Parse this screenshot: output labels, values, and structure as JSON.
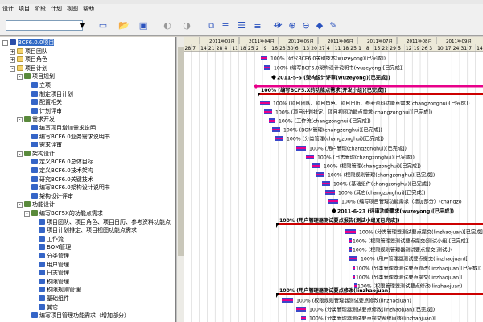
{
  "menu": [
    "设计",
    "项目",
    "阶段",
    "计划",
    "视图",
    "帮助"
  ],
  "toolbar": {
    "search_value": "",
    "search_icon": "filter-icon",
    "buttons": [
      "page-icon",
      "open-icon",
      "save-icon",
      "undo-icon",
      "redo-icon",
      "copy-icon",
      "paste-icon",
      "align-icon",
      "align-center-icon",
      "indent-icon",
      "refresh-icon",
      "zoom-in-icon",
      "zoom-out-icon",
      "tag-icon",
      "paint-icon"
    ]
  },
  "tree": [
    {
      "level": 0,
      "label": "BCF6.0.0项目",
      "icon": "root",
      "expander": "-",
      "selected": true
    },
    {
      "level": 1,
      "label": "项目团队",
      "icon": "folder",
      "expander": "+"
    },
    {
      "level": 1,
      "label": "项目角色",
      "icon": "folder",
      "expander": "+"
    },
    {
      "level": 1,
      "label": "项目计划",
      "icon": "folder",
      "expander": "-"
    },
    {
      "level": 2,
      "label": "项目规划",
      "icon": "summary",
      "expander": "-"
    },
    {
      "level": 3,
      "label": "立项",
      "icon": "task"
    },
    {
      "level": 3,
      "label": "制定项目计划",
      "icon": "task"
    },
    {
      "level": 3,
      "label": "配置相关",
      "icon": "task"
    },
    {
      "level": 3,
      "label": "计划评审",
      "icon": "task"
    },
    {
      "level": 2,
      "label": "需求开发",
      "icon": "summary",
      "expander": "-"
    },
    {
      "level": 3,
      "label": "编写项目增加需求说明",
      "icon": "task"
    },
    {
      "level": 3,
      "label": "编写BCF6.0业务需求说明书",
      "icon": "task"
    },
    {
      "level": 3,
      "label": "需求评审",
      "icon": "task"
    },
    {
      "level": 2,
      "label": "架构设计",
      "icon": "summary",
      "expander": "-"
    },
    {
      "level": 3,
      "label": "定义BCF6.0总体目标",
      "icon": "task"
    },
    {
      "level": 3,
      "label": "定义BCF6.0技术架构",
      "icon": "task"
    },
    {
      "level": 3,
      "label": "研究BCF6.0关键技术",
      "icon": "task"
    },
    {
      "level": 3,
      "label": "编写BCF6.0架构设计说明书",
      "icon": "task"
    },
    {
      "level": 3,
      "label": "架构设计评审",
      "icon": "task"
    },
    {
      "level": 2,
      "label": "功能设计",
      "icon": "summary",
      "expander": "-"
    },
    {
      "level": 3,
      "label": "编写BCF5X的功能点需求",
      "icon": "summary",
      "expander": "-"
    },
    {
      "level": 4,
      "label": "项目团队、项目角色、项目日历、参考资料功能点",
      "icon": "task"
    },
    {
      "level": 4,
      "label": "项目计划排定、项目视图功能点需求",
      "icon": "task"
    },
    {
      "level": 4,
      "label": "工作流",
      "icon": "task"
    },
    {
      "level": 4,
      "label": "BOM管理",
      "icon": "task"
    },
    {
      "level": 4,
      "label": "分类管理",
      "icon": "task"
    },
    {
      "level": 4,
      "label": "用户管理",
      "icon": "task"
    },
    {
      "level": 4,
      "label": "日志管理",
      "icon": "task"
    },
    {
      "level": 4,
      "label": "权限管理",
      "icon": "task"
    },
    {
      "level": 4,
      "label": "权限规则管理",
      "icon": "task"
    },
    {
      "level": 4,
      "label": "基础组件",
      "icon": "task"
    },
    {
      "level": 4,
      "label": "其它",
      "icon": "task"
    },
    {
      "level": 3,
      "label": "编写项目管理功能需求（增加部分）",
      "icon": "task"
    }
  ],
  "gantt": {
    "months": [
      "2011年03月",
      "2011年04月",
      "2011年05月",
      "2011年06月",
      "2011年07月",
      "2011年08月",
      "2011年09月"
    ],
    "days": [
      "28",
      "7",
      "14",
      "21",
      "28",
      "4",
      "11",
      "18",
      "25",
      "2",
      "9",
      "16",
      "23",
      "30",
      "6",
      "13",
      "20",
      "27",
      "4",
      "11",
      "18",
      "25",
      "1",
      "8",
      "15",
      "22",
      "29",
      "5",
      "12",
      "19",
      "26",
      "3",
      "10",
      "17",
      "24",
      "31",
      "7",
      "14"
    ],
    "task_labels": [
      "100% (研究BCF6.0关键技术(wuzeyong)[已完成])",
      "100% (编写BCF6.0架构设计说明书(wuzeyong)[已完成])",
      "2011-5-5 (架构设计评审(wuzeyong)[已完成])",
      "100% (编写BCF5.X的功能点需求(开发小组)[已完成])",
      "100% (项目团队、项目角色、项目日历、参考资料功能点需求(changzonghui)[已完成])",
      "100% (项目计划排定、项目视图功能点需求(changzonghui)[已完成])",
      "100% (工作流(changzonghui)[已完成])",
      "100% (BOM管理(changzonghui)[已完成])",
      "100% (分类管理(changzonghui)[已完成])",
      "100% (用户管理(changzonghui)[已完成])",
      "100% (日志管理(changzonghui)[已完成])",
      "100% (权限管理(changzonghui)[已完成])",
      "100% (权限规则管理(changzonghui)[已完成])",
      "100% (基础组件(changzonghui)[已完成])",
      "100% (其它(changzonghui)[已完成])",
      "100% (编写项目管理功能需求（增加部分）(changzo",
      "2011-6-23 (评审功能需求(wuzeyong)[已完成])",
      "100% (用户管理器测试要点报告(测试小组)[已完成])",
      "100% (分类管理器测试要点提交(linzhaojuan)[已完成])",
      "100% (权限管理器测试要点提交(测试小组)[已完成])",
      "100% (权限规则管理器测试要点提交(测试小",
      "100% (用户管理器测试要点提交(linzhaojuan)[",
      "100% (分类管理器测试要点修改(linzhaojuan)[已完成])",
      "100% (分类管理器测试要点提交(linzhaojuan)[",
      "100% (权限管理器测试要点修改(linzhaojuan)",
      "100% (用户管理器测试要点修改(linzhaojuan)",
      "100% (权限规则管理器测试要点修改(linzhaojuan)",
      "100% (分类管理器测试要点修改(linzhaojuan)[已完成])",
      "100% (分类管理器测试要点提交系统审核(linzhaojuan)["
    ]
  },
  "colors": {
    "summary": "#cc0000",
    "task": "#3a47c9",
    "milestone": "#000000",
    "critical": "#e8008a",
    "grid": "#c8c8c8"
  }
}
